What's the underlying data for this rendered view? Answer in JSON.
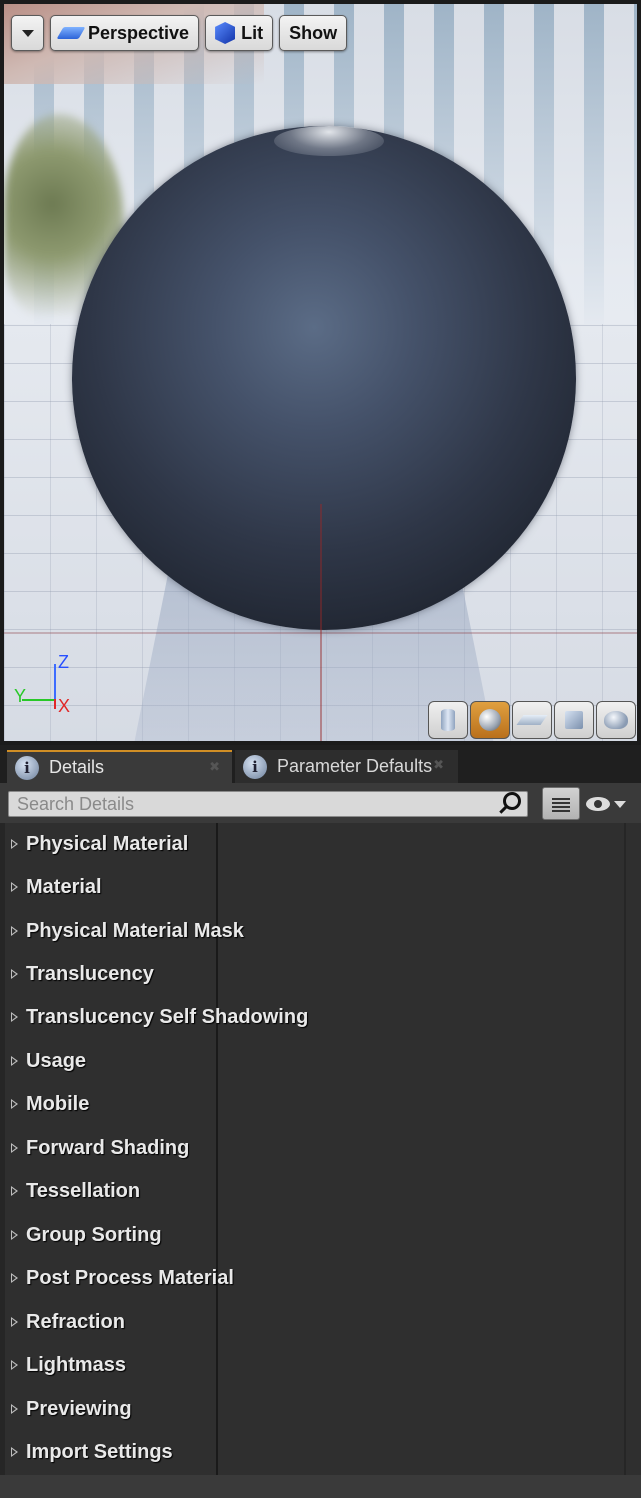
{
  "viewport": {
    "toolbar": {
      "perspective_label": "Perspective",
      "lit_label": "Lit",
      "show_label": "Show"
    },
    "gizmo": {
      "z": "Z",
      "y": "Y",
      "x": "X"
    },
    "preview_shapes": [
      "cylinder-icon",
      "sphere-icon",
      "plane-icon",
      "cube-icon",
      "teapot-icon"
    ],
    "active_shape": "sphere-icon"
  },
  "tabs": {
    "details": "Details",
    "parameter_defaults": "Parameter Defaults",
    "close_glyph": "✖"
  },
  "search": {
    "placeholder": "Search Details"
  },
  "categories": [
    "Physical Material",
    "Material",
    "Physical Material Mask",
    "Translucency",
    "Translucency Self Shadowing",
    "Usage",
    "Mobile",
    "Forward Shading",
    "Tessellation",
    "Group Sorting",
    "Post Process Material",
    "Refraction",
    "Lightmass",
    "Previewing",
    "Import Settings"
  ],
  "colors": {
    "active_tab_accent": "#d08e25",
    "active_shape_button": "#e0a040"
  }
}
